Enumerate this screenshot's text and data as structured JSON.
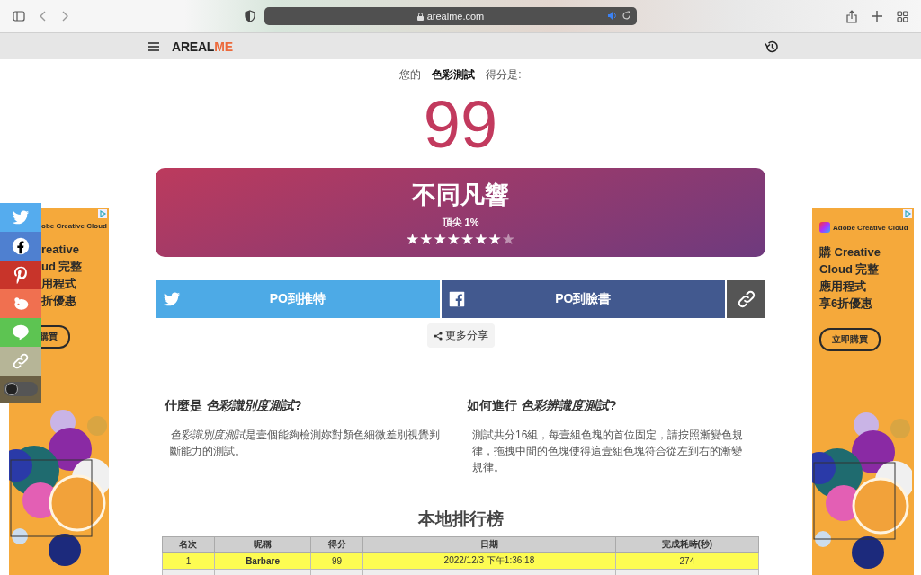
{
  "browser": {
    "address": "arealme.com"
  },
  "site_header": {
    "logo": [
      {
        "text": "AREAL",
        "accent": false
      },
      {
        "text": "ME",
        "accent": true
      }
    ]
  },
  "result": {
    "prefix": "您的",
    "test_name": "色彩測試",
    "suffix": "得分是:",
    "score": "99"
  },
  "banner": {
    "title": "不同凡響",
    "subtitle": "頂尖 1%",
    "stars": 7
  },
  "share_buttons": [
    {
      "kind": "twitter",
      "label": "PO到推特"
    },
    {
      "kind": "facebook",
      "label": "PO到臉書"
    },
    {
      "kind": "link"
    }
  ],
  "more_share": "更多分享",
  "side_share": [
    {
      "kind": "twitter",
      "color": "#55acee"
    },
    {
      "kind": "facebook",
      "color": "#4f80d0"
    },
    {
      "kind": "pinterest",
      "color": "#c8342a"
    },
    {
      "kind": "weibo",
      "color": "#f07050"
    },
    {
      "kind": "line",
      "color": "#5dc452"
    },
    {
      "kind": "link",
      "color": "#b6b597"
    },
    {
      "kind": "toggle",
      "color": "#6b6045"
    }
  ],
  "info": [
    {
      "heading": "什麼是 *色彩識別度測試*?",
      "body": [
        {
          "text": "色彩識別度測試",
          "italic": true
        },
        {
          "text": "是壹個能夠檢測妳對顏色細微差別視覺判斷能力的測試。",
          "italic": false
        }
      ]
    },
    {
      "heading": "如何進行 *色彩辨識度測試*?",
      "body": [
        {
          "text": "測試共分16組，每壹組色塊的首位固定，請按照漸變色規律，拖拽中間的色塊使得這壹組色塊符合從左到右的漸變規律。",
          "italic": false
        }
      ]
    }
  ],
  "leaderboard": {
    "title": "本地排行榜",
    "columns": [
      "名次",
      "昵稱",
      "得分",
      "日期",
      "完成耗時(秒)"
    ],
    "rows": [
      {
        "cells": [
          "1",
          "Barbare",
          "99",
          "2022/12/3 下午1:36:18",
          "274"
        ],
        "highlighted": true
      },
      {
        "cells": [],
        "highlighted": false
      }
    ]
  },
  "ads": [
    {
      "brand": "obe Creative Cloud",
      "lines": [
        "reative",
        "ud 完整",
        "用程式",
        "折優惠"
      ],
      "button": "購買"
    },
    {
      "brand": "Adobe Creative Cloud",
      "lines": [
        "購 Creative",
        "Cloud 完整",
        "應用程式",
        "享6折優惠"
      ],
      "button": "立即購買"
    }
  ]
}
